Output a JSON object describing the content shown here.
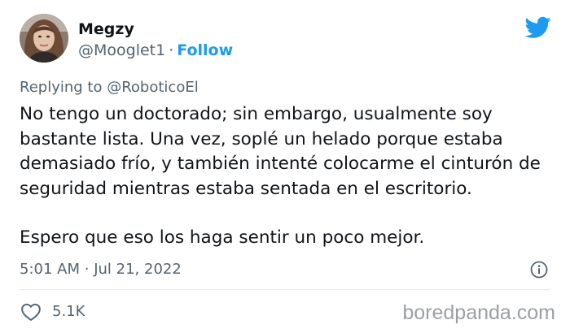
{
  "author": {
    "name": "Megzy",
    "handle": "@Mooglet1",
    "separator": "·",
    "follow_label": "Follow"
  },
  "reply": {
    "prefix": "Replying to",
    "mention": "@RoboticoEl"
  },
  "tweet": {
    "paragraph_1": "No tengo un doctorado; sin embargo, usualmente soy bastante lista. Una vez, soplé un helado porque estaba demasiado frío, y también intenté colocarme el cinturón de seguridad mientras estaba sentada en el escritorio.",
    "paragraph_2": "Espero que eso los haga sentir un poco mejor."
  },
  "meta": {
    "time": "5:01 AM",
    "separator": "·",
    "date": "Jul 21, 2022"
  },
  "stats": {
    "likes": "5.1K"
  },
  "watermark": "boredpanda.com",
  "icons": {
    "brand": "twitter-bird-icon",
    "info": "info-icon",
    "like": "heart-icon"
  },
  "colors": {
    "accent": "#1d9bf0",
    "text": "#0f1419",
    "secondary": "#536471",
    "divider": "#e5e9ec"
  }
}
